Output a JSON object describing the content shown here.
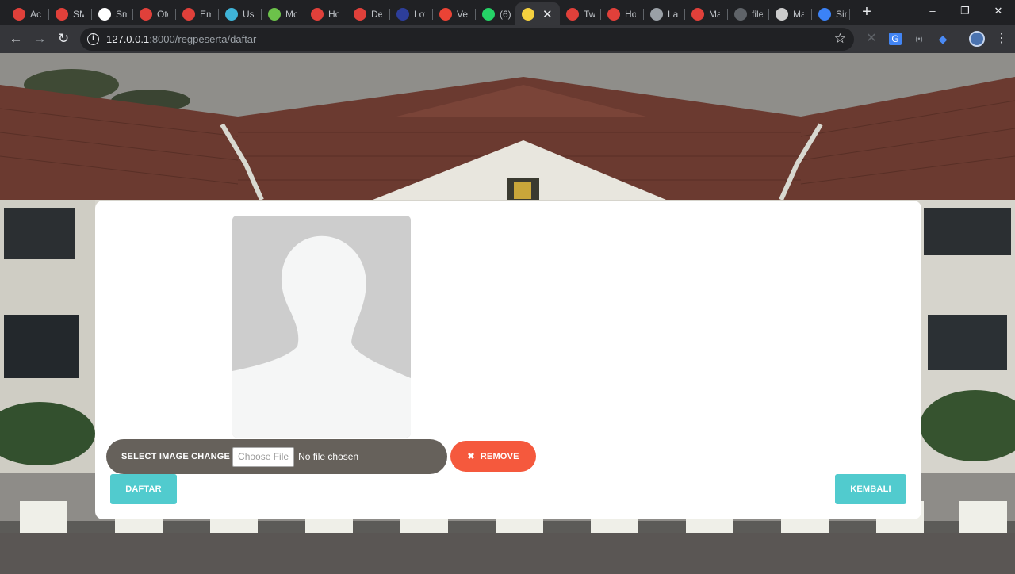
{
  "browser": {
    "tabs": [
      {
        "title": "Acc",
        "icon": "laravel-icon",
        "color": "#e0403a"
      },
      {
        "title": "SM",
        "icon": "laravel-icon",
        "color": "#e0403a"
      },
      {
        "title": "Sm",
        "icon": "medium-icon",
        "color": "#ffffff"
      },
      {
        "title": "Oto",
        "icon": "dw-icon",
        "color": "#e0403a"
      },
      {
        "title": "Em",
        "icon": "laravel-logo-icon",
        "color": "#e0403a"
      },
      {
        "title": "Use",
        "icon": "html5-icon",
        "color": "#3fb4d8"
      },
      {
        "title": "Mo",
        "icon": "node-icon",
        "color": "#6cc24a"
      },
      {
        "title": "Ho",
        "icon": "laravel-icon",
        "color": "#e0403a"
      },
      {
        "title": "Det",
        "icon": "laravel-icon",
        "color": "#e0403a"
      },
      {
        "title": "Lov",
        "icon": "j-icon",
        "color": "#2d3e9a"
      },
      {
        "title": "Ver",
        "icon": "gmail-icon",
        "color": "#ea4335"
      },
      {
        "title": "(6)",
        "icon": "whatsapp-icon",
        "color": "#25d366"
      },
      {
        "title": "",
        "icon": "emblem-icon",
        "color": "#f4d03f"
      },
      {
        "title": "Twi",
        "icon": "laravel-icon",
        "color": "#e0403a"
      },
      {
        "title": "Ho",
        "icon": "laravel-icon",
        "color": "#e0403a"
      },
      {
        "title": "Lar",
        "icon": "gear-icon",
        "color": "#9aa0a6"
      },
      {
        "title": "Ma",
        "icon": "laravel-logo-icon",
        "color": "#e0403a"
      },
      {
        "title": "file",
        "icon": "github-icon",
        "color": "#5f6368"
      },
      {
        "title": "Ma",
        "icon": "bow-icon",
        "color": "#cccccc"
      },
      {
        "title": "Sin",
        "icon": "p-icon",
        "color": "#3b82f6"
      }
    ],
    "active_tab_index": 12,
    "new_tab_symbol": "+",
    "window": {
      "minimize": "–",
      "restore": "❐",
      "close": "✕"
    },
    "nav": {
      "back": "←",
      "forward": "→",
      "reload": "↻"
    },
    "url_host": "127.0.0.1",
    "url_rest": ":8000/regpeserta/daftar",
    "star": "☆"
  },
  "form": {
    "photo_alt": "default avatar placeholder",
    "select_image_label": "SELECT IMAGE CHANGE",
    "choose_file_label": "Choose File",
    "no_file_text": "No file chosen",
    "remove_label": "REMOVE",
    "remove_icon": "✖",
    "submit_label": "DAFTAR",
    "back_label": "KEMBALI"
  },
  "colors": {
    "accent_teal": "#51cbce",
    "remove_orange": "#f5593d",
    "file_bar": "#66615b"
  }
}
